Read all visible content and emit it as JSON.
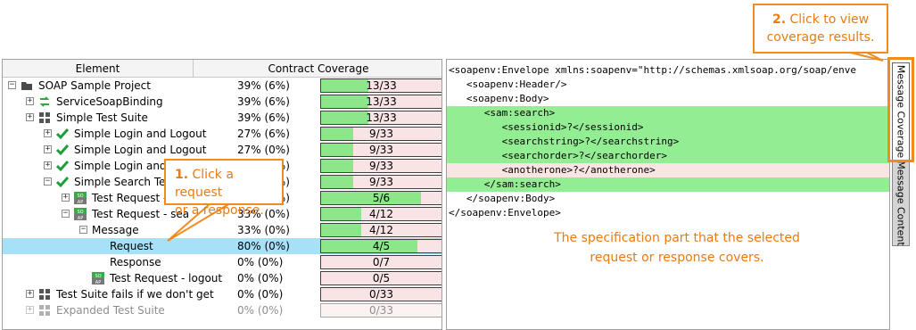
{
  "tree": {
    "columns": {
      "element": "Element",
      "contract_coverage": "Contract Coverage"
    },
    "rows": [
      {
        "label": "SOAP Sample Project",
        "pct": "39% (6%)",
        "ratio": "13/33",
        "fill": 0.39,
        "icon": "folder-icon",
        "expander": "−"
      },
      {
        "label": "ServiceSoapBinding",
        "pct": "39% (6%)",
        "ratio": "13/33",
        "fill": 0.39,
        "icon": "binding-arrows-icon",
        "expander": "+"
      },
      {
        "label": "Simple Test Suite",
        "pct": "39% (6%)",
        "ratio": "13/33",
        "fill": 0.39,
        "icon": "test-suite-grid-icon",
        "expander": "+"
      },
      {
        "label": "Simple Login and Logout",
        "pct": "27% (6%)",
        "ratio": "9/33",
        "fill": 0.27,
        "icon": "checkmark-icon",
        "expander": "+"
      },
      {
        "label": "Simple Login and Logout",
        "pct": "27% (0%)",
        "ratio": "9/33",
        "fill": 0.27,
        "icon": "checkmark-icon",
        "expander": "+"
      },
      {
        "label": "Simple Login and L",
        "pct": "27% (0%)",
        "ratio": "9/33",
        "fill": 0.27,
        "icon": "checkmark-icon",
        "expander": "+"
      },
      {
        "label": "Simple Search TestC",
        "pct": "27% (0%)",
        "ratio": "9/33",
        "fill": 0.27,
        "icon": "checkmark-icon",
        "expander": "−"
      },
      {
        "label": "Test Request - l",
        "pct": "83% (0%)",
        "ratio": "5/6",
        "fill": 0.83,
        "icon": "soap-request-icon",
        "expander": "+"
      },
      {
        "label": "Test Request - sea",
        "pct": "33% (0%)",
        "ratio": "4/12",
        "fill": 0.33,
        "icon": "soap-request-icon",
        "expander": "−"
      },
      {
        "label": "Message",
        "pct": "33% (0%)",
        "ratio": "4/12",
        "fill": 0.33,
        "icon": "",
        "expander": "−"
      },
      {
        "label": "Request",
        "pct": "80% (0%)",
        "ratio": "4/5",
        "fill": 0.8,
        "icon": "",
        "expander": ""
      },
      {
        "label": "Response",
        "pct": "0% (0%)",
        "ratio": "0/7",
        "fill": 0.0,
        "icon": "",
        "expander": ""
      },
      {
        "label": "Test Request - logout",
        "pct": "0% (0%)",
        "ratio": "0/5",
        "fill": 0.0,
        "icon": "soap-request-icon",
        "expander": ""
      },
      {
        "label": "Test Suite fails if we don't get",
        "pct": "0% (0%)",
        "ratio": "0/33",
        "fill": 0.0,
        "icon": "test-suite-grid-icon",
        "expander": "+"
      },
      {
        "label": "Expanded Test Suite",
        "pct": "0% (0%)",
        "ratio": "0/33",
        "fill": 0.0,
        "icon": "test-suite-grid-icon",
        "expander": "+"
      }
    ]
  },
  "xml": {
    "lines": [
      {
        "text": "<soapenv:Envelope xmlns:soapenv=\"http://schemas.xmlsoap.org/soap/enve",
        "hl": ""
      },
      {
        "text": "   <soapenv:Header/>",
        "hl": ""
      },
      {
        "text": "   <soapenv:Body>",
        "hl": ""
      },
      {
        "text": "      <sam:search>",
        "hl": "green"
      },
      {
        "text": "         <sessionid>?</sessionid>",
        "hl": "green"
      },
      {
        "text": "         <searchstring>?</searchstring>",
        "hl": "green"
      },
      {
        "text": "         <searchorder>?</searchorder>",
        "hl": "green"
      },
      {
        "text": "         <anotherone>?</anotherone>",
        "hl": "pink"
      },
      {
        "text": "      </sam:search>",
        "hl": "green"
      },
      {
        "text": "   </soapenv:Body>",
        "hl": ""
      },
      {
        "text": "</soapenv:Envelope>",
        "hl": ""
      }
    ]
  },
  "tabs": {
    "coverage": "Message Coverage",
    "content": "Message Content"
  },
  "callouts": {
    "one_num": "1.",
    "one_text_a": "Click a request",
    "one_text_b": "or a response.",
    "two_num": "2.",
    "two_text_a": "Click to view",
    "two_text_b": "coverage results."
  },
  "note": "The specification part that the selected request or response covers.",
  "colors": {
    "accent": "#f08c1e",
    "covered": "#8ee68a",
    "uncovered": "#f8e4e4",
    "selected": "#a7e1f7"
  }
}
